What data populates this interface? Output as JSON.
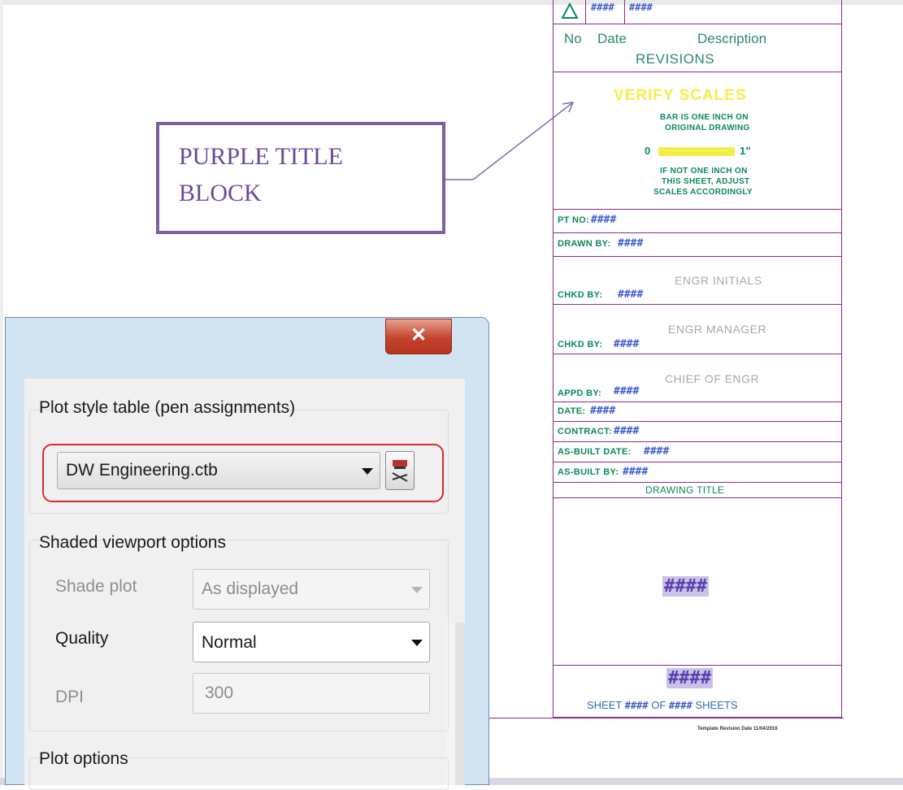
{
  "title_block": {
    "rev_row_marks": [
      "####",
      "####"
    ],
    "rev_header": {
      "no": "No",
      "date": "Date",
      "description": "Description"
    },
    "revisions_label": "REVISIONS",
    "verify_scales": "VERIFY SCALES",
    "bar_note": [
      "BAR IS ONE INCH ON",
      "ORIGINAL DRAWING"
    ],
    "scale_zero": "0",
    "scale_one": "1\"",
    "adjust_note": [
      "IF NOT ONE INCH ON",
      "THIS SHEET, ADJUST",
      "SCALES ACCORDINGLY"
    ],
    "fields": [
      {
        "label": "PT NO:",
        "value": "####"
      },
      {
        "label": "DRAWN BY:",
        "value": "####"
      },
      {
        "label": "CHKD BY:",
        "value": "####",
        "note": "ENGR INITIALS"
      },
      {
        "label": "CHKD BY:",
        "value": "####",
        "note": "ENGR MANAGER"
      },
      {
        "label": "APPD BY:",
        "value": "####",
        "note": "CHIEF OF ENGR"
      },
      {
        "label": "DATE:",
        "value": "####"
      },
      {
        "label": "CONTRACT:",
        "value": "####"
      },
      {
        "label": "AS-BUILT DATE:",
        "value": "####"
      },
      {
        "label": "AS-BUILT BY:",
        "value": "####"
      }
    ],
    "drawing_title_label": "DRAWING TITLE",
    "drawing_title_value": "####",
    "sheet_number": "####",
    "sheet_line": {
      "sheet": "SHEET",
      "current": "####",
      "of": "OF",
      "total": "####",
      "sheets": "SHEETS"
    },
    "template_note": "Template Revision Date 11/04/2016"
  },
  "callout": {
    "lines": [
      "PURPLE TITLE",
      "BLOCK"
    ]
  },
  "dialog": {
    "close_label": "✕",
    "plot_style_group": "Plot style table (pen assignments)",
    "plot_style_value": "DW Engineering.ctb",
    "shaded_group": "Shaded viewport options",
    "shade_plot_label": "Shade plot",
    "shade_plot_value": "As displayed",
    "quality_label": "Quality",
    "quality_value": "Normal",
    "dpi_label": "DPI",
    "dpi_value": "300",
    "plot_options_group": "Plot options"
  },
  "colors": {
    "title_block_border": "#8a2a8a",
    "title_block_text": "#0a8a55",
    "verify_scales": "#f2ef4a",
    "highlight": "#e0282f",
    "callout_border": "#7d5fa0"
  }
}
